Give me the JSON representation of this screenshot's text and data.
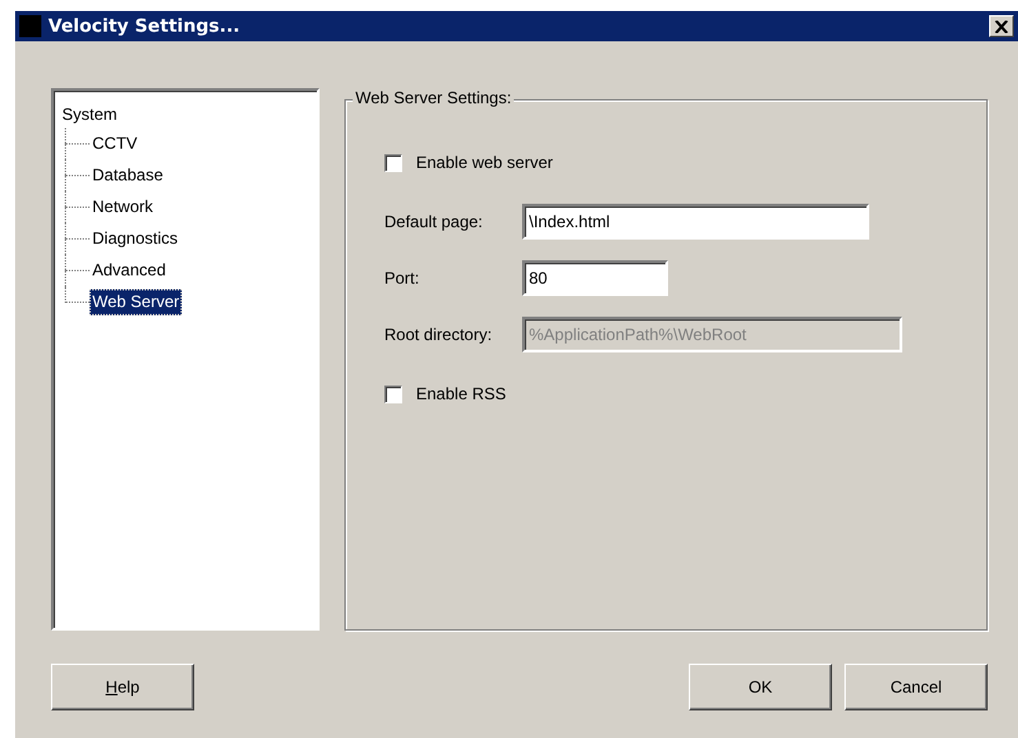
{
  "window": {
    "title": "Velocity Settings..."
  },
  "tree": [
    {
      "label": "System",
      "selected": false,
      "children": [
        {
          "label": "CCTV",
          "selected": false
        },
        {
          "label": "Database",
          "selected": false
        },
        {
          "label": "Network",
          "selected": false
        },
        {
          "label": "Diagnostics",
          "selected": false
        },
        {
          "label": "Advanced",
          "selected": false
        },
        {
          "label": "Web Server",
          "selected": true
        }
      ]
    }
  ],
  "group": {
    "title": "Web Server Settings:",
    "items": [
      {
        "kind": "checkbox",
        "label": "Enable web server",
        "checked": false
      },
      {
        "kind": "field",
        "label": "Default page:",
        "value": "\\Index.html",
        "disabled": false
      },
      {
        "kind": "field",
        "label": "Port:",
        "value": "80",
        "disabled": false
      },
      {
        "kind": "field",
        "label": "Root directory:",
        "value": "%ApplicationPath%\\WebRoot",
        "disabled": true
      },
      {
        "kind": "checkbox",
        "label": "Enable RSS",
        "checked": false
      }
    ]
  },
  "buttons": [
    {
      "label": "Help"
    },
    {
      "label": "OK"
    },
    {
      "label": "Cancel"
    }
  ]
}
